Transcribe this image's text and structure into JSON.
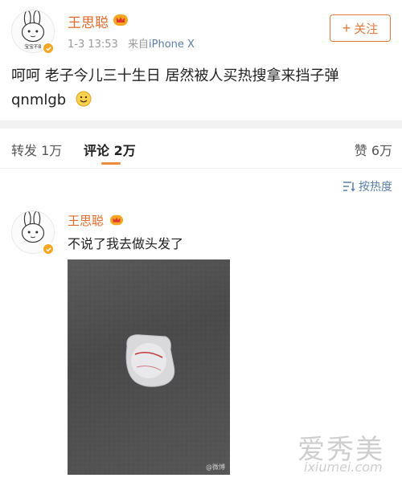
{
  "post": {
    "username": "王思聪",
    "time": "1-3 13:53",
    "source_prefix": "来自",
    "source": "iPhone X",
    "follow_label": "关注",
    "follow_icon": "plus-icon",
    "text": "呵呵 老子今儿三十生日 居然被人买热搜拿来挡子弹 qnmlgb",
    "avatar_text": "宝宝不B"
  },
  "tabs": {
    "repost_label": "转发",
    "repost_count": "1万",
    "comment_label": "评论",
    "comment_count": "2万",
    "like_label": "赞",
    "like_count": "6万"
  },
  "sort": {
    "label": "按热度",
    "icon": "sort-icon"
  },
  "comment": {
    "username": "王思聪",
    "text": "不说了我去做头发了",
    "photo_watermark": "@微博"
  },
  "watermark": {
    "title": "爱秀美",
    "subtitle": "ixiumei.com"
  },
  "colors": {
    "accent": "#e06b2a",
    "link": "#5b7fa6",
    "tab_underline": "#f08a3c",
    "verified": "#f5a623"
  }
}
